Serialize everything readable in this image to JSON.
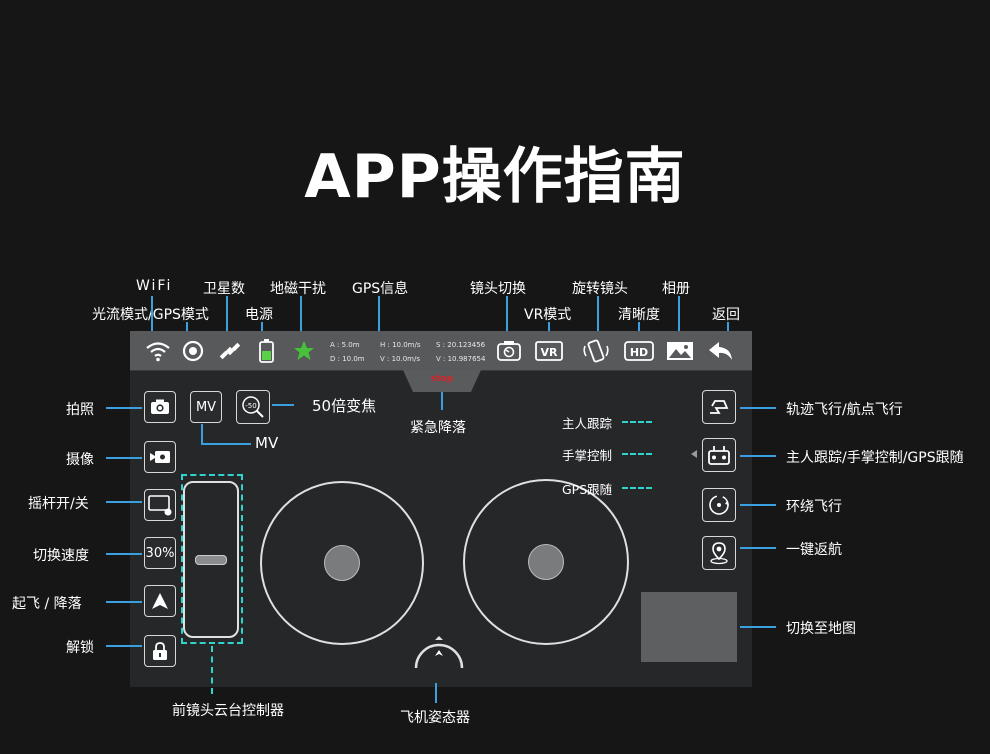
{
  "title": "APP操作指南",
  "top_labels": {
    "wifi": "WiFi",
    "satellites": "卫星数",
    "compass": "地磁干扰",
    "gps_info": "GPS信息",
    "lens_switch": "镜头切换",
    "rotate_lens": "旋转镜头",
    "album": "相册",
    "optical_gps": "光流模式/GPS模式",
    "power": "电源",
    "vr": "VR模式",
    "resolution": "清晰度",
    "back": "返回"
  },
  "sensor": {
    "a": "A : 5.0m",
    "d": "D : 10.0m",
    "h": "H : 10.0m/s",
    "v": "V : 10.0m/s",
    "s": "S : 20.123456",
    "v2": "V : 10.987654"
  },
  "stop_label": "stop",
  "emergency_label": "紧急降落",
  "mv_button": "MV",
  "mv_label": "MV",
  "zoom_button": "-50",
  "zoom_label": "50倍变焦",
  "speed_button": "30%",
  "left_labels": {
    "photo": "拍照",
    "video": "摄像",
    "joystick": "摇杆开/关",
    "speed": "切换速度",
    "takeoff": "起飞 / 降落",
    "unlock": "解锁"
  },
  "follow_modes": {
    "owner": "主人跟踪",
    "palm": "手掌控制",
    "gps": "GPS跟随"
  },
  "right_labels": {
    "trajectory": "轨迹飞行/航点飞行",
    "follow": "主人跟踪/手掌控制/GPS跟随",
    "orbit": "环绕飞行",
    "rth": "一键返航",
    "map": "切换至地图"
  },
  "bottom_labels": {
    "gimbal": "前镜头云台控制器",
    "attitude": "飞机姿态器"
  },
  "colors": {
    "background": "#161616",
    "leader_line": "#3aa0e0",
    "dashed": "#2fd4cc",
    "stop_red": "#d8232a"
  }
}
